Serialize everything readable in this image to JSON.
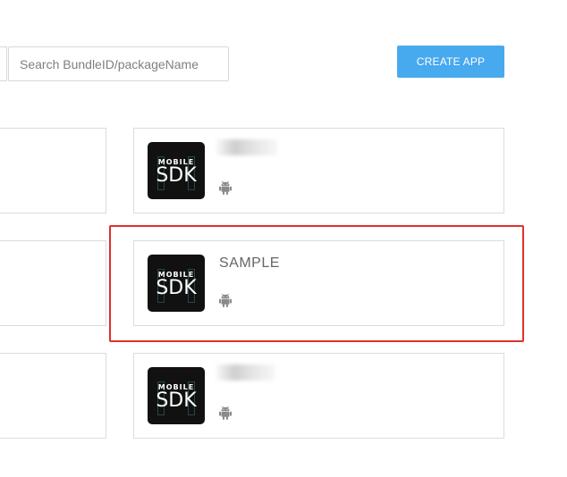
{
  "toolbar": {
    "search_placeholder": "Search BundleID/packageName",
    "search_value": "",
    "create_app_label": "CREATE APP",
    "accent_color": "#47a9ee"
  },
  "app_icon": {
    "line1": "MOBILE",
    "line2": "SDK"
  },
  "apps": [
    {
      "name": "",
      "platform_icon": "android-icon",
      "name_obscured": true
    },
    {
      "name": "SAMPLE",
      "platform_icon": "android-icon",
      "name_obscured": false,
      "highlighted": true
    },
    {
      "name": "",
      "platform_icon": "android-icon",
      "name_obscured": true
    }
  ],
  "highlight_color": "#e0312b"
}
